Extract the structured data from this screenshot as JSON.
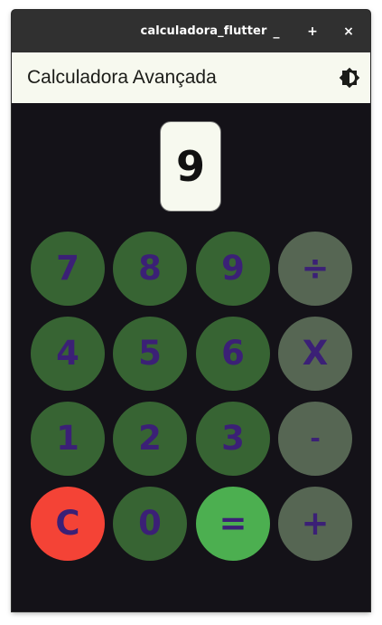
{
  "window": {
    "title": "calculadora_flutter",
    "minimize_label": "_",
    "maximize_label": "+",
    "close_label": "×"
  },
  "appbar": {
    "title": "Calculadora Avançada",
    "theme_icon": "brightness-medium-icon"
  },
  "display": {
    "value": "9"
  },
  "keypad": {
    "rows": [
      [
        "7",
        "8",
        "9",
        "÷"
      ],
      [
        "4",
        "5",
        "6",
        "X"
      ],
      [
        "1",
        "2",
        "3",
        "-"
      ],
      [
        "C",
        "0",
        "=",
        "+"
      ]
    ]
  },
  "colors": {
    "window_background": "#141218",
    "appbar_background": "#f7f9ef",
    "titlebar_background": "#303030",
    "number_key": "#376433",
    "operator_key": "#566653",
    "clear_key": "#f44336",
    "equals_key": "#4caf50",
    "key_text": "#3b2076"
  }
}
